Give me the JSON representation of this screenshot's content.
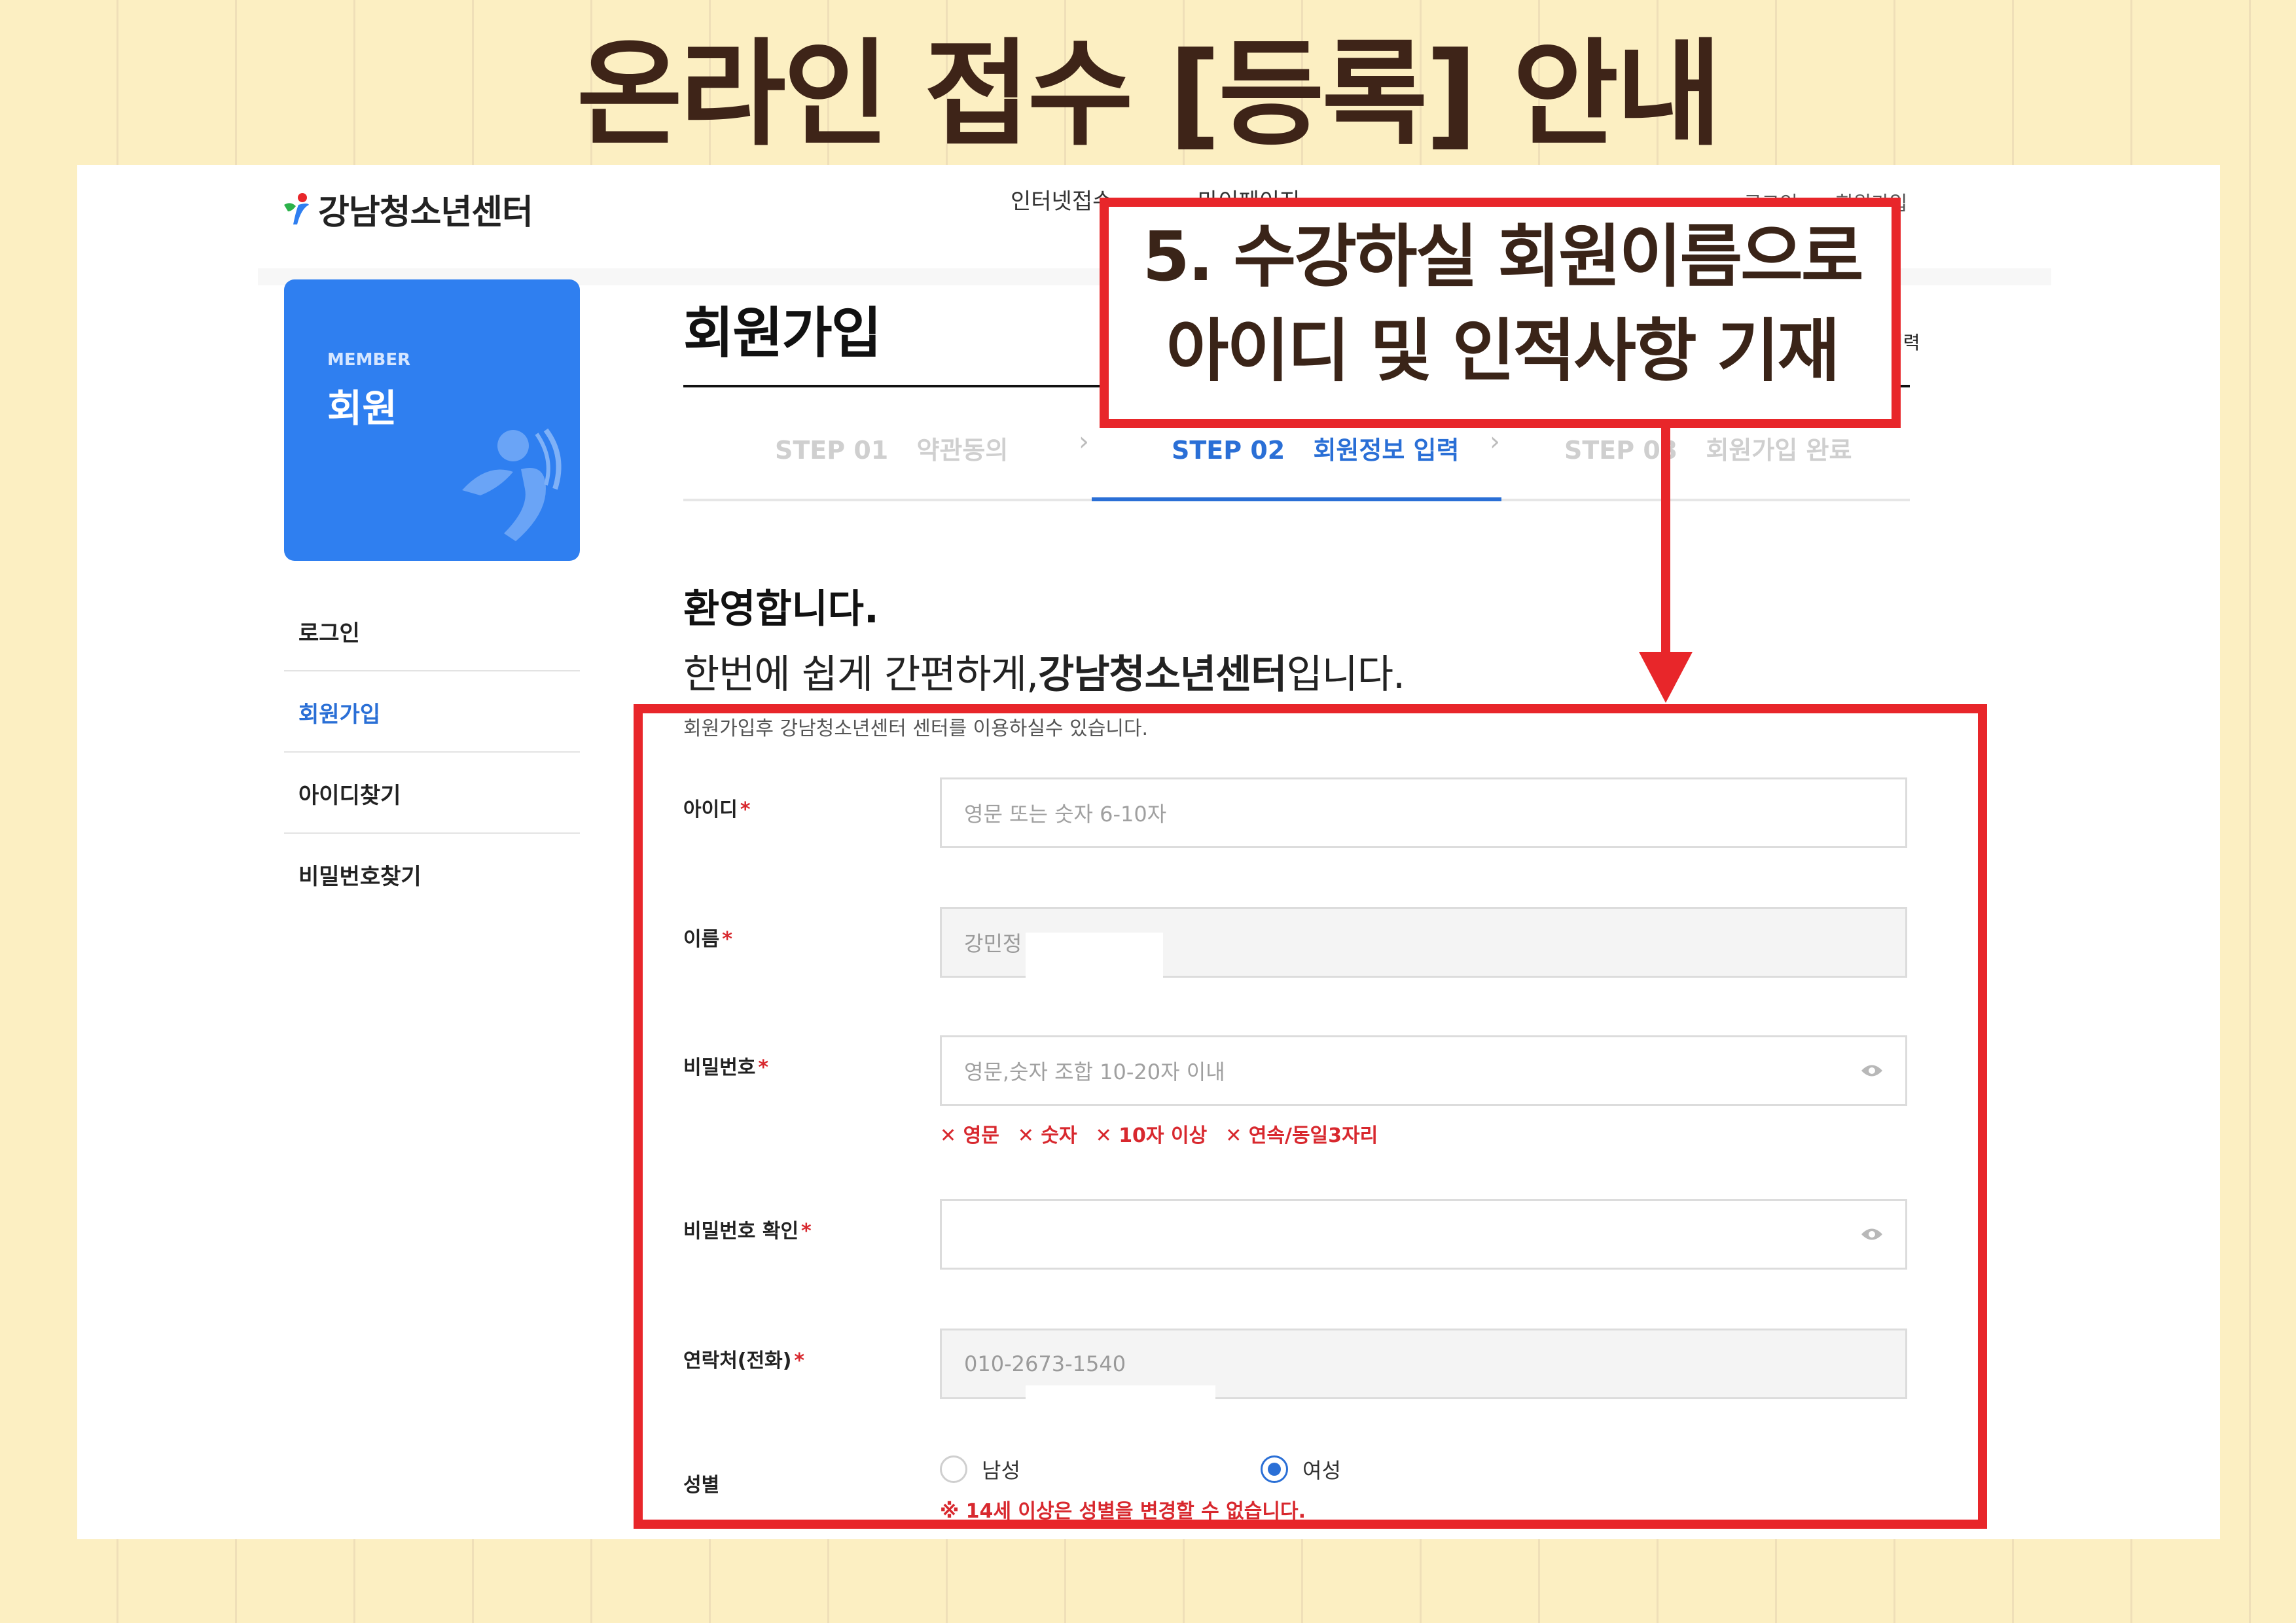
{
  "heading": "온라인 접수 [등록] 안내",
  "site": {
    "name": "강남청소년센터",
    "nav": [
      "인터넷접수",
      "마이페이지"
    ],
    "util": [
      "로그인",
      "회원가입"
    ]
  },
  "sidebar": {
    "card_sub": "MEMBER",
    "card_title": "회원",
    "items": [
      {
        "label": "로그인"
      },
      {
        "label": "회원가입",
        "active": true
      },
      {
        "label": "아이디찾기"
      },
      {
        "label": "비밀번호찾기"
      }
    ]
  },
  "page": {
    "title": "회원가입",
    "current_step_label": "회원정보 입력"
  },
  "steps": [
    {
      "num": "STEP 01",
      "label": "약관동의"
    },
    {
      "num": "STEP 02",
      "label": "회원정보 입력"
    },
    {
      "num": "STEP 03",
      "label": "회원가입 완료"
    }
  ],
  "welcome": {
    "heading": "환영합니다.",
    "line_prefix": "한번에 쉽게 간편하게,",
    "line_bold": "강남청소년센터",
    "line_suffix": "입니다.",
    "notice": "회원가입후 강남청소년센터 센터를 이용하실수 있습니다."
  },
  "form": {
    "required_mark": "*",
    "id": {
      "label": "아이디",
      "placeholder": "영문 또는 숫자 6-10자"
    },
    "name": {
      "label": "이름",
      "value": "강민정"
    },
    "password": {
      "label": "비밀번호",
      "placeholder": "영문,숫자 조합 10-20자 이내"
    },
    "password_rules": [
      "영문",
      "숫자",
      "10자 이상",
      "연속/동일3자리"
    ],
    "password_confirm": {
      "label": "비밀번호 확인"
    },
    "phone": {
      "label": "연락처(전화)",
      "value": "010-2673-1540"
    },
    "gender": {
      "label": "성별",
      "options": [
        {
          "label": "남성",
          "selected": false
        },
        {
          "label": "여성",
          "selected": true
        }
      ],
      "note": "※ 14세 이상은 성별을 변경할 수 없습니다."
    }
  },
  "callout": {
    "line1": "5. 수강하실 회원이름으로",
    "line2": "아이디 및 인적사항 기재"
  },
  "colors": {
    "annotation_red": "#e8262a",
    "primary_blue": "#2f7ff0",
    "background": "#fcefc2"
  }
}
